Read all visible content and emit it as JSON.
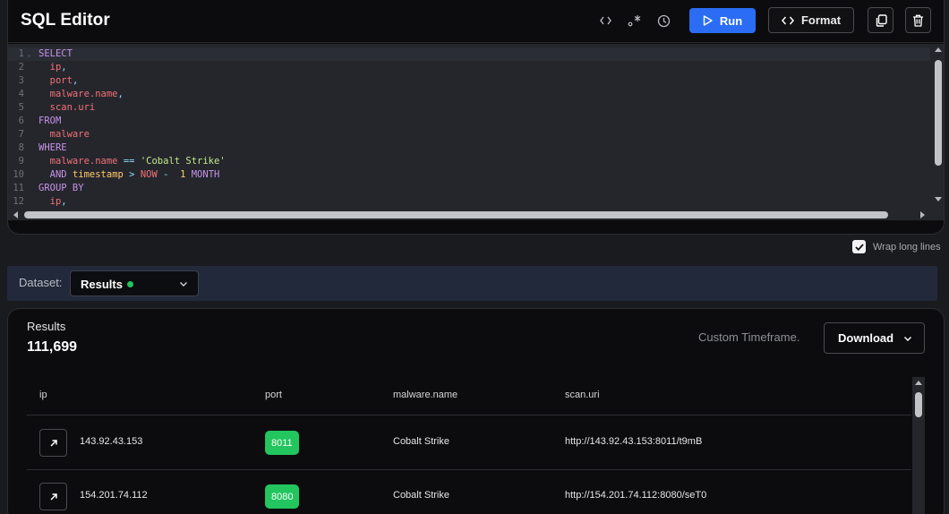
{
  "editor": {
    "title": "SQL Editor",
    "icons": [
      "code-icon",
      "regex-icon",
      "history-icon"
    ],
    "run_label": "Run",
    "format_label": "Format",
    "lines": [
      {
        "n": "1",
        "fold": "⌄",
        "tokens": [
          {
            "t": "SELECT",
            "c": "kw"
          }
        ]
      },
      {
        "n": "2",
        "tokens": [
          {
            "t": "  ip",
            "c": "id"
          },
          {
            "t": ",",
            "c": "op"
          }
        ]
      },
      {
        "n": "3",
        "tokens": [
          {
            "t": "  port",
            "c": "id"
          },
          {
            "t": ",",
            "c": "op"
          }
        ]
      },
      {
        "n": "4",
        "tokens": [
          {
            "t": "  malware.name",
            "c": "id"
          },
          {
            "t": ",",
            "c": "op"
          }
        ]
      },
      {
        "n": "5",
        "tokens": [
          {
            "t": "  scan.uri",
            "c": "id"
          }
        ]
      },
      {
        "n": "6",
        "tokens": [
          {
            "t": "FROM",
            "c": "kw"
          }
        ]
      },
      {
        "n": "7",
        "tokens": [
          {
            "t": "  malware",
            "c": "id"
          }
        ]
      },
      {
        "n": "8",
        "tokens": [
          {
            "t": "WHERE",
            "c": "kw"
          }
        ]
      },
      {
        "n": "9",
        "tokens": [
          {
            "t": "  malware.name",
            "c": "id"
          },
          {
            "t": " == ",
            "c": "op"
          },
          {
            "t": "'Cobalt Strike'",
            "c": "str"
          }
        ]
      },
      {
        "n": "10",
        "tokens": [
          {
            "t": "  AND ",
            "c": "kw"
          },
          {
            "t": "timestamp",
            "c": "fn"
          },
          {
            "t": " > ",
            "c": "op"
          },
          {
            "t": "NOW",
            "c": "id"
          },
          {
            "t": " -  ",
            "c": "op"
          },
          {
            "t": "1",
            "c": "fn"
          },
          {
            "t": " MONTH",
            "c": "kw"
          }
        ]
      },
      {
        "n": "11",
        "tokens": [
          {
            "t": "GROUP BY",
            "c": "kw"
          }
        ]
      },
      {
        "n": "12",
        "tokens": [
          {
            "t": "  ip",
            "c": "id"
          },
          {
            "t": ",",
            "c": "op"
          }
        ]
      }
    ]
  },
  "wrap": {
    "label": "Wrap long lines",
    "checked": true
  },
  "dataset": {
    "label": "Dataset:",
    "value": "Results",
    "status_color": "#22c55e"
  },
  "results": {
    "title": "Results",
    "count": "111,699",
    "timeframe": "Custom Timeframe.",
    "download_label": "Download",
    "columns": [
      "ip",
      "port",
      "malware.name",
      "scan.uri"
    ],
    "rows": [
      {
        "ip": "143.92.43.153",
        "port": "8011",
        "malware": "Cobalt Strike",
        "uri": "http://143.92.43.153:8011/t9mB"
      },
      {
        "ip": "154.201.74.112",
        "port": "8080",
        "malware": "Cobalt Strike",
        "uri": "http://154.201.74.112:8080/seT0"
      }
    ]
  },
  "colors": {
    "accent": "#2a6df4",
    "port_badge": "#22c55e",
    "dataset_bar": "#22293a"
  }
}
